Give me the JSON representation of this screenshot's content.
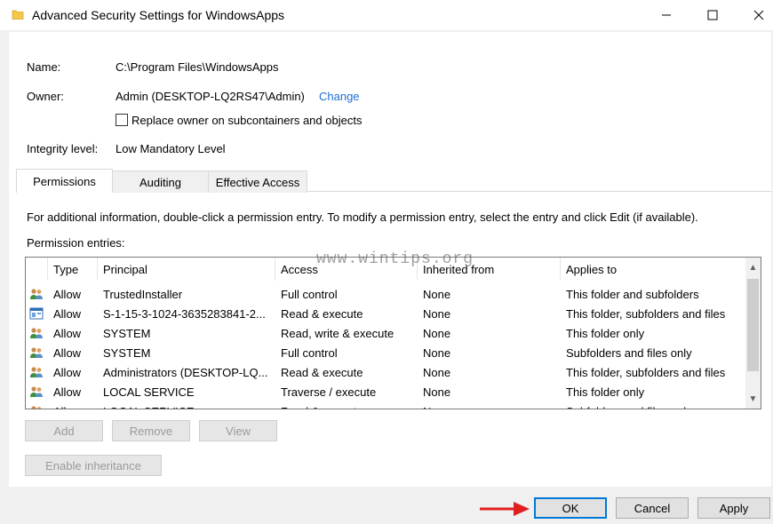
{
  "window": {
    "title": "Advanced Security Settings for WindowsApps",
    "controls": {
      "minimize": "—",
      "maximize": "☐",
      "close": "✕"
    }
  },
  "info": {
    "name_label": "Name:",
    "name_value": "C:\\Program Files\\WindowsApps",
    "owner_label": "Owner:",
    "owner_value": "Admin (DESKTOP-LQ2RS47\\Admin)",
    "change_link": "Change",
    "replace_owner_label": "Replace owner on subcontainers and objects",
    "integrity_label": "Integrity level:",
    "integrity_value": "Low Mandatory Level"
  },
  "tabs": [
    {
      "label": "Permissions",
      "active": true
    },
    {
      "label": "Auditing",
      "active": false
    },
    {
      "label": "Effective Access",
      "active": false
    }
  ],
  "permissions": {
    "instructions": "For additional information, double-click a permission entry. To modify a permission entry, select the entry and click Edit (if available).",
    "entries_label": "Permission entries:",
    "columns": [
      "Type",
      "Principal",
      "Access",
      "Inherited from",
      "Applies to"
    ],
    "rows": [
      {
        "icon": "users-icon",
        "type": "Allow",
        "principal": "TrustedInstaller",
        "access": "Full control",
        "inherited": "None",
        "applies": "This folder and subfolders"
      },
      {
        "icon": "app-package-icon",
        "type": "Allow",
        "principal": "S-1-15-3-1024-3635283841-2...",
        "access": "Read & execute",
        "inherited": "None",
        "applies": "This folder, subfolders and files"
      },
      {
        "icon": "users-icon",
        "type": "Allow",
        "principal": "SYSTEM",
        "access": "Read, write & execute",
        "inherited": "None",
        "applies": "This folder only"
      },
      {
        "icon": "users-icon",
        "type": "Allow",
        "principal": "SYSTEM",
        "access": "Full control",
        "inherited": "None",
        "applies": "Subfolders and files only"
      },
      {
        "icon": "users-icon",
        "type": "Allow",
        "principal": "Administrators (DESKTOP-LQ...",
        "access": "Read & execute",
        "inherited": "None",
        "applies": "This folder, subfolders and files"
      },
      {
        "icon": "users-icon",
        "type": "Allow",
        "principal": "LOCAL SERVICE",
        "access": "Traverse / execute",
        "inherited": "None",
        "applies": "This folder only"
      },
      {
        "icon": "users-icon",
        "type": "Allow",
        "principal": "LOCAL SERVICE",
        "access": "Read & execute",
        "inherited": "None",
        "applies": "Subfolders and files only"
      }
    ]
  },
  "buttons": {
    "add": "Add",
    "remove": "Remove",
    "view": "View",
    "enable_inheritance": "Enable inheritance",
    "ok": "OK",
    "cancel": "Cancel",
    "apply": "Apply"
  },
  "watermark": "www.wintips.org",
  "colors": {
    "link": "#1a6fd6",
    "arrow": "#e02020",
    "focus_border": "#0078d7"
  }
}
